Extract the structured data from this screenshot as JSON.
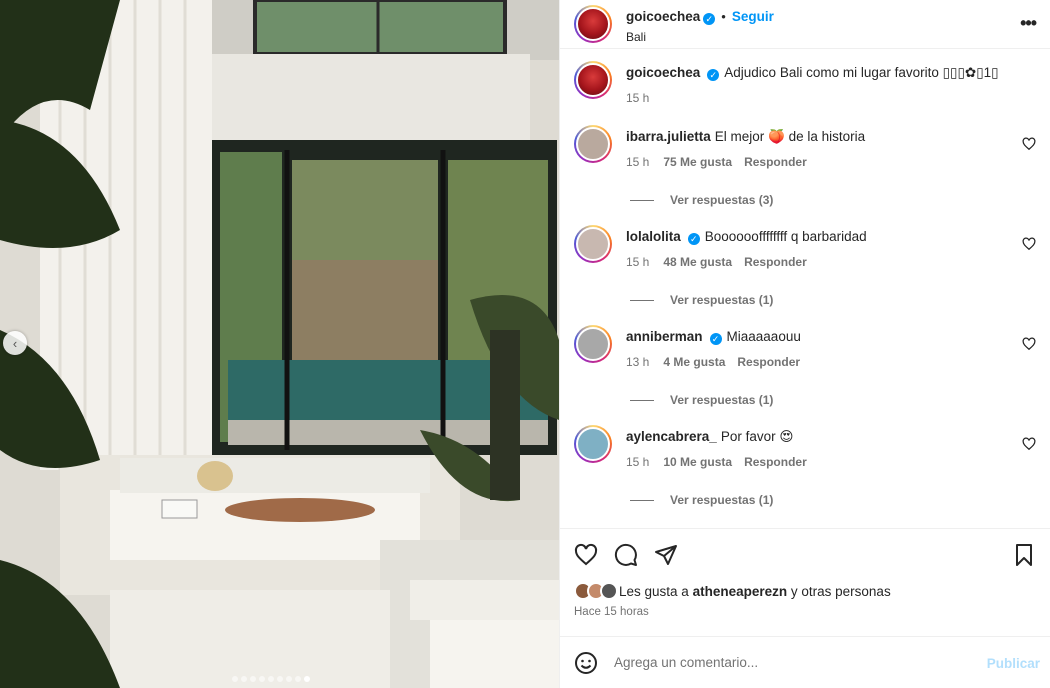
{
  "post": {
    "username": "goicoechea",
    "follow_label": "Seguir",
    "separator": "•",
    "location": "Bali",
    "more_label": "•••",
    "verified_mark": "✓"
  },
  "caption": {
    "username": "goicoechea",
    "text": "Adjudico Bali como mi lugar favorito ▯▯▯✿▯1▯",
    "time": "15 h"
  },
  "comments": [
    {
      "username": "ibarra.julietta",
      "verified": false,
      "text": "El mejor 🍑 de la historia",
      "time": "15 h",
      "likes": "75 Me gusta",
      "reply": "Responder",
      "replies": "Ver respuestas (3)",
      "avatar_color": "#b9a99e"
    },
    {
      "username": "lolalolita",
      "verified": true,
      "text": "Booooooffffffff q barbaridad",
      "time": "15 h",
      "likes": "48 Me gusta",
      "reply": "Responder",
      "replies": "Ver respuestas (1)",
      "avatar_color": "#c8b8b0"
    },
    {
      "username": "anniberman",
      "verified": true,
      "text": "Miaaaaaouu",
      "time": "13 h",
      "likes": "4 Me gusta",
      "reply": "Responder",
      "replies": "Ver respuestas (1)",
      "avatar_color": "#a8a8a8"
    },
    {
      "username": "aylencabrera_",
      "verified": false,
      "text": "Por favor 😍",
      "time": "15 h",
      "likes": "10 Me gusta",
      "reply": "Responder",
      "replies": "Ver respuestas (1)",
      "avatar_color": "#7fb0c4"
    }
  ],
  "likes": {
    "prefix": "Les gusta a",
    "user": "atheneaperezn",
    "suffix": "y otras personas"
  },
  "timestamp": "Hace 15 horas",
  "composer": {
    "placeholder": "Agrega un comentario...",
    "publish": "Publicar"
  },
  "carousel": {
    "total": 9,
    "active": 9
  },
  "colors": {
    "accent": "#0095f6",
    "publish_disabled": "#b2dffc"
  }
}
